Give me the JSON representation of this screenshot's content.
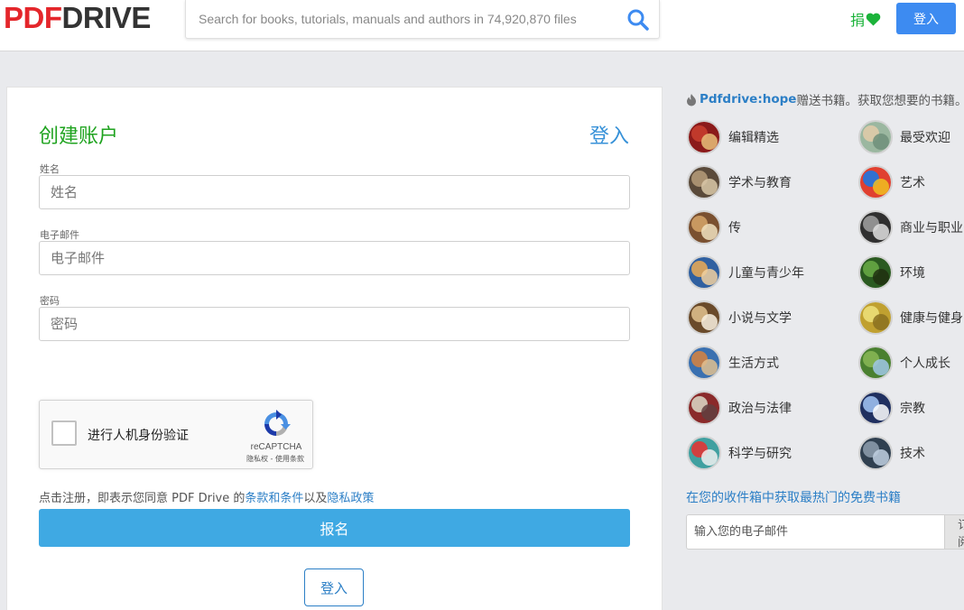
{
  "header": {
    "logo_pdf": "PDF",
    "logo_drive": "DRIVE",
    "search_placeholder": "Search for books, tutorials, manuals and authors in 74,920,870 files",
    "donate_label": "捐",
    "login_label": "登入"
  },
  "form": {
    "title": "创建账户",
    "login_link": "登入",
    "name_label": "姓名",
    "name_placeholder": "姓名",
    "email_label": "电子邮件",
    "email_placeholder": "电子邮件",
    "password_label": "密码",
    "password_placeholder": "密码",
    "captcha_label": "进行人机身份验证",
    "captcha_brand": "reCAPTCHA",
    "captcha_links": "隐私权 - 使用条款",
    "terms_prefix": "点击注册，即表示您同意 PDF Drive 的",
    "terms_link": "条款和条件",
    "terms_middle": "以及",
    "privacy_link": "隐私政策",
    "signup_label": "报名",
    "login_bottom_label": "登入"
  },
  "sidebar": {
    "promo_link": "Pdfdrive:hope",
    "promo_text": "赠送书籍。获取您想要的书籍。",
    "categories": [
      {
        "label": "编辑精选",
        "icon": "editors-choice-icon"
      },
      {
        "label": "最受欢迎",
        "icon": "most-popular-icon"
      },
      {
        "label": "学术与教育",
        "icon": "academic-education-icon"
      },
      {
        "label": "艺术",
        "icon": "art-icon"
      },
      {
        "label": "传",
        "icon": "biography-icon"
      },
      {
        "label": "商业与职业",
        "icon": "business-career-icon"
      },
      {
        "label": "儿童与青少年",
        "icon": "children-youth-icon"
      },
      {
        "label": "环境",
        "icon": "environment-icon"
      },
      {
        "label": "小说与文学",
        "icon": "fiction-literature-icon"
      },
      {
        "label": "健康与健身",
        "icon": "health-fitness-icon"
      },
      {
        "label": "生活方式",
        "icon": "lifestyle-icon"
      },
      {
        "label": "个人成长",
        "icon": "personal-growth-icon"
      },
      {
        "label": "政治与法律",
        "icon": "politics-law-icon"
      },
      {
        "label": "宗教",
        "icon": "religion-icon"
      },
      {
        "label": "科学与研究",
        "icon": "science-research-icon"
      },
      {
        "label": "技术",
        "icon": "technology-icon"
      }
    ],
    "newsletter_title": "在您的收件箱中获取最热门的免费书籍",
    "newsletter_placeholder": "输入您的电子邮件",
    "newsletter_button": "订阅"
  },
  "colors": {
    "accent_blue": "#3d8bf1",
    "signup_blue": "#3fa9e3",
    "title_green": "#1fa31f",
    "logo_red": "#e4262b",
    "link_blue": "#2c7fc6"
  }
}
